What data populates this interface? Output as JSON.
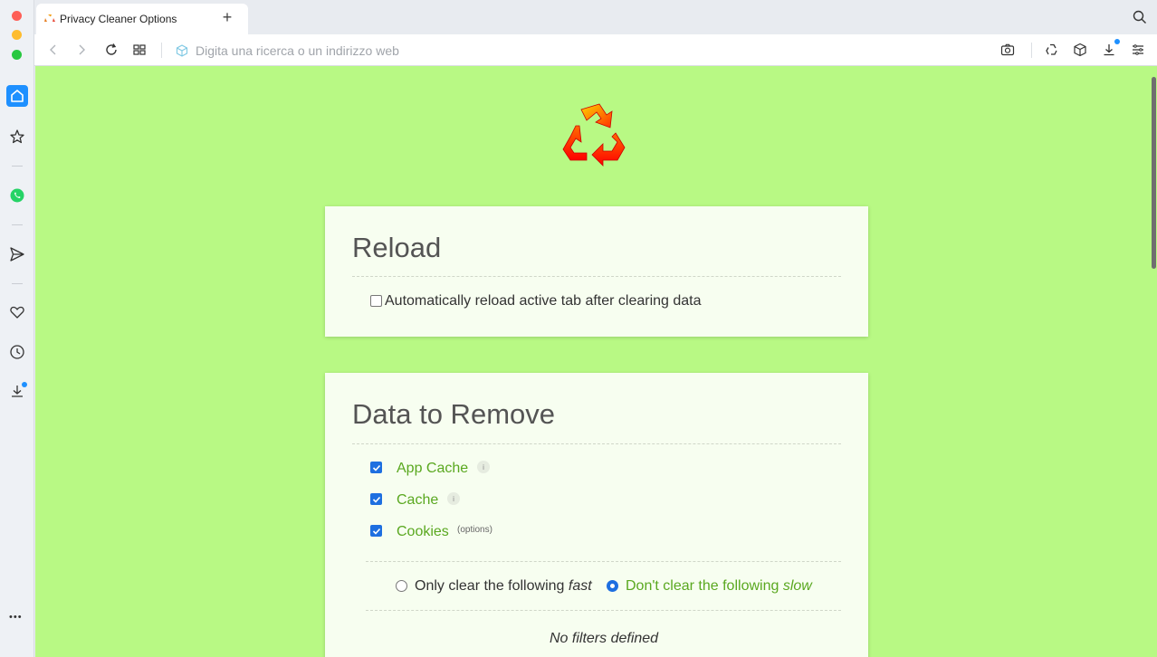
{
  "window": {
    "tab_title": "Privacy Cleaner Options",
    "new_tab_symbol": "+"
  },
  "toolbar": {
    "address_placeholder": "Digita una ricerca o un indirizzo web"
  },
  "sidebar": {
    "items": [
      "home-icon",
      "star-icon",
      "whatsapp-icon",
      "send-icon",
      "heart-icon",
      "history-icon",
      "download-icon",
      "more-icon"
    ],
    "more_symbol": "•••"
  },
  "page": {
    "reload": {
      "title": "Reload",
      "checkbox_label": "Automatically reload active tab after clearing data",
      "checked": false
    },
    "data_to_remove": {
      "title": "Data to Remove",
      "items": [
        {
          "label": "App Cache",
          "checked": true,
          "info": "i"
        },
        {
          "label": "Cache",
          "checked": true,
          "info": "i"
        },
        {
          "label": "Cookies",
          "checked": true,
          "extra": "(options)"
        }
      ],
      "radio_fast": {
        "text": "Only clear the following",
        "emph": "fast",
        "selected": false
      },
      "radio_slow": {
        "text": "Don't clear the following",
        "emph": "slow",
        "selected": true
      },
      "no_filters": "No filters defined"
    }
  },
  "colors": {
    "page_bg": "#b8f984",
    "card_bg": "#f7fef0",
    "accent_green": "#5aa820",
    "checkbox_blue": "#1e6fe0"
  }
}
